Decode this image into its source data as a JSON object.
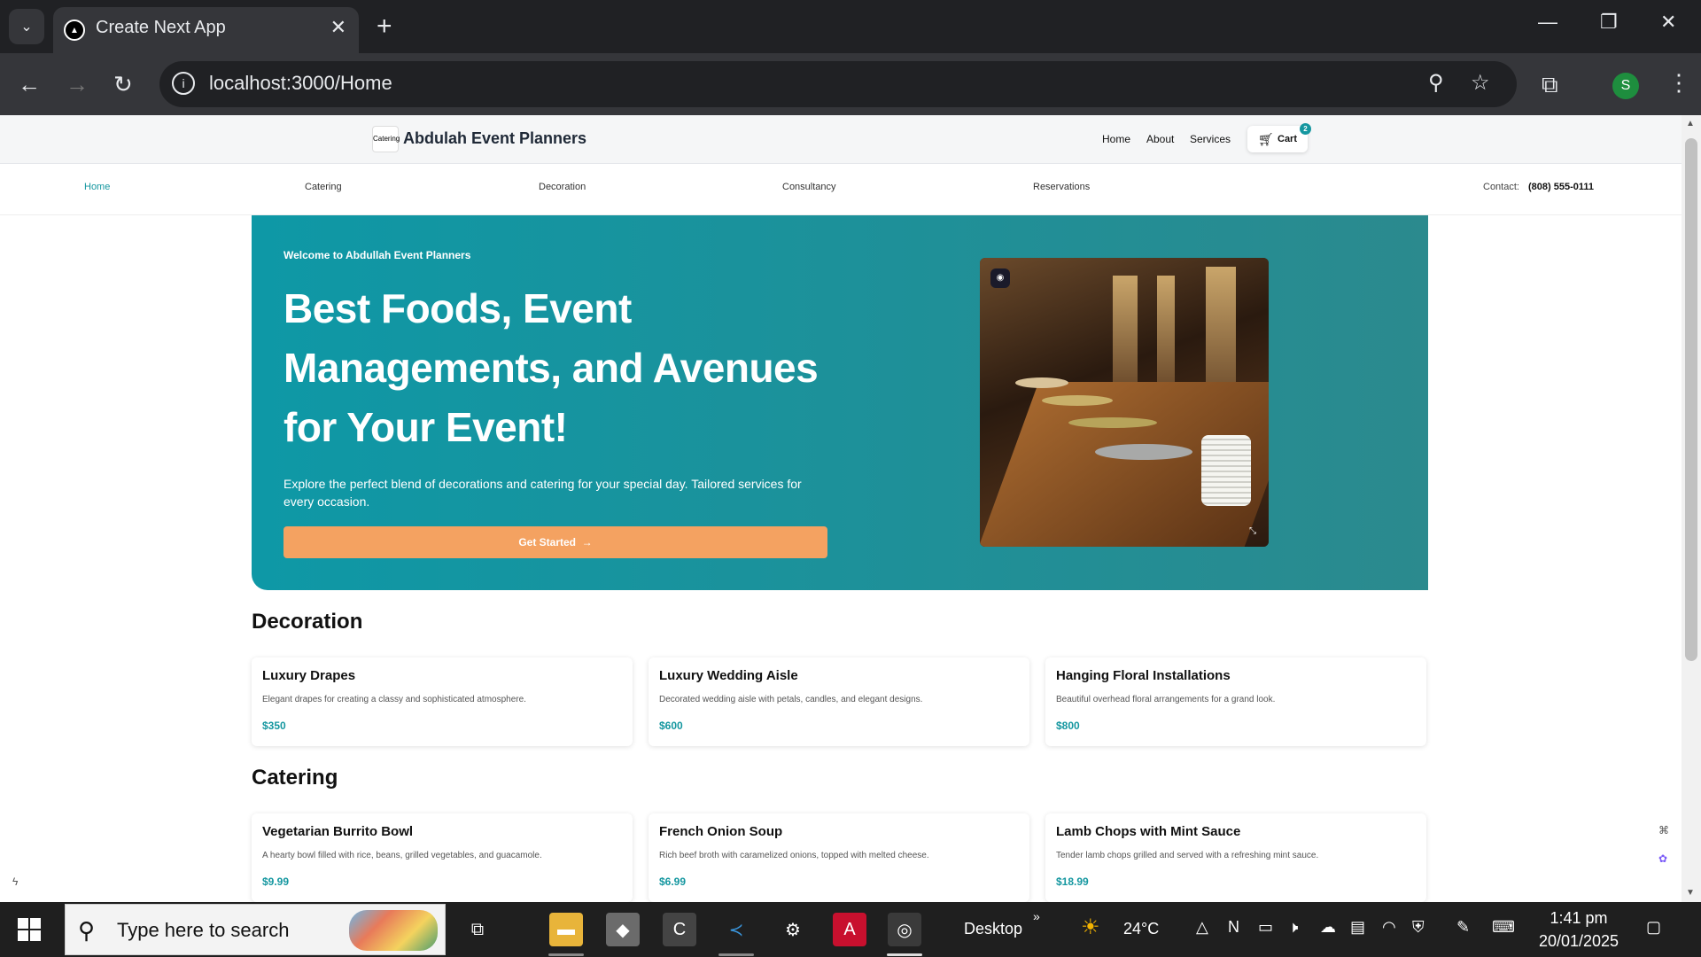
{
  "browser": {
    "tab_title": "Create Next App",
    "url": "localhost:3000/Home",
    "profile_initial": "S"
  },
  "site": {
    "brand": "Abdulah Event Planners",
    "logo_text": "Catering",
    "topnav": [
      "Home",
      "About",
      "Services"
    ],
    "cart_label": "Cart",
    "cart_count": "2",
    "subnav": [
      "Home",
      "Catering",
      "Decoration",
      "Consultancy",
      "Reservations"
    ],
    "active_subnav": "Home",
    "contact_label": "Contact:",
    "contact_value": "(808) 555-0111"
  },
  "hero": {
    "welcome": "Welcome to Abdullah Event Planners",
    "title": "Best Foods, Event Managements, and Avenues for Your Event!",
    "description": "Explore the perfect blend of decorations and catering for your special day. Tailored services for every occasion.",
    "cta": "Get Started",
    "cta_icon": "arrow-right-icon"
  },
  "sections": [
    {
      "title": "Decoration",
      "items": [
        {
          "name": "Luxury Drapes",
          "desc": "Elegant drapes for creating a classy and sophisticated atmosphere.",
          "price": "$350"
        },
        {
          "name": "Luxury Wedding Aisle",
          "desc": "Decorated wedding aisle with petals, candles, and elegant designs.",
          "price": "$600"
        },
        {
          "name": "Hanging Floral Installations",
          "desc": "Beautiful overhead floral arrangements for a grand look.",
          "price": "$800"
        }
      ]
    },
    {
      "title": "Catering",
      "items": [
        {
          "name": "Vegetarian Burrito Bowl",
          "desc": "A hearty bowl filled with rice, beans, grilled vegetables, and guacamole.",
          "price": "$9.99"
        },
        {
          "name": "French Onion Soup",
          "desc": "Rich beef broth with caramelized onions, topped with melted cheese.",
          "price": "$6.99"
        },
        {
          "name": "Lamb Chops with Mint Sauce",
          "desc": "Tender lamb chops grilled and served with a refreshing mint sauce.",
          "price": "$18.99"
        }
      ]
    }
  ],
  "taskbar": {
    "search_placeholder": "Type here to search",
    "desktop_label": "Desktop",
    "weather": "24°C",
    "time": "1:41 pm",
    "date": "20/01/2025"
  },
  "colors": {
    "accent": "#1597a0",
    "cta": "#f4a261"
  }
}
